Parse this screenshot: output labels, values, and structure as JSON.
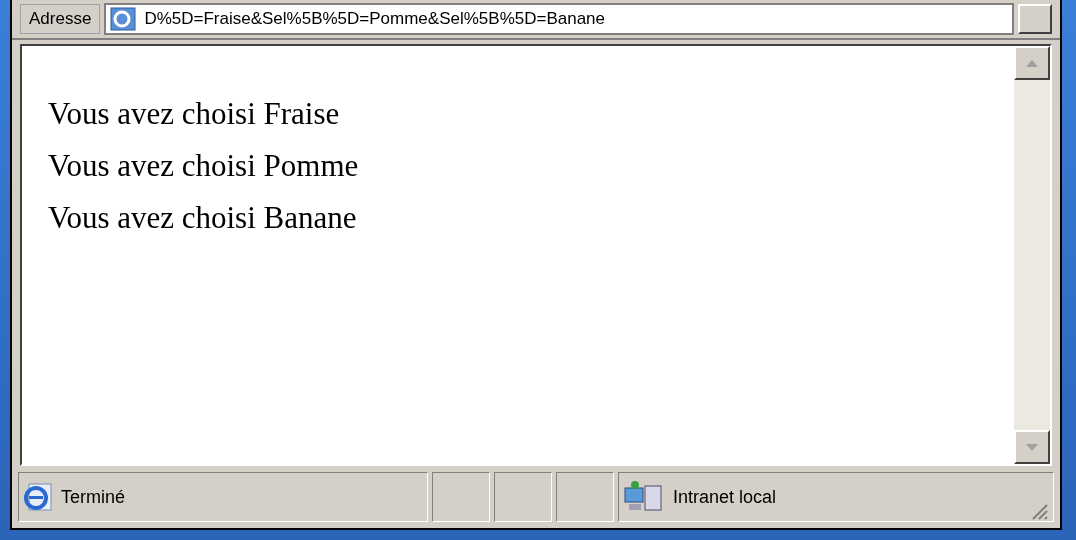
{
  "address_bar": {
    "label": "Adresse",
    "url": "D%5D=Fraise&Sel%5B%5D=Pomme&Sel%5B%5D=Banane"
  },
  "content": {
    "lines": [
      "Vous avez choisi Fraise",
      "Vous avez choisi Pomme",
      "Vous avez choisi Banane"
    ]
  },
  "status_bar": {
    "status": "Terminé",
    "zone": "Intranet local"
  }
}
